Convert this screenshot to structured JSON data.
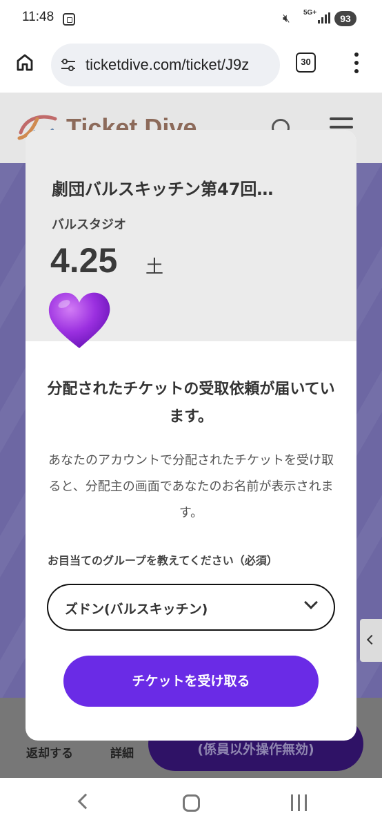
{
  "status_bar": {
    "time": "11:48",
    "network": "5G+",
    "battery": "93"
  },
  "browser": {
    "url": "ticketdive.com/ticket/J9z",
    "tab_count": "30"
  },
  "page": {
    "logo_text": "Ticket Dive",
    "footer": {
      "return_label": "返却する",
      "detail_label": "詳細",
      "operate_label": "(係員以外操作無効)"
    }
  },
  "modal": {
    "title": "劇団バルスキッチン第47回…",
    "venue": "バルスタジオ",
    "date": "4.25",
    "day": "土",
    "heart_icon": "purple-heart",
    "notice_heading": "分配されたチケットの受取依頼が届いています。",
    "notice_body": "あなたのアカウントで分配されたチケットを受け取ると、分配主の画面であなたのお名前が表示されます。",
    "group_label": "お目当てのグループを教えてください（必須）",
    "group_selected": "ズドン(バルスキッチン)",
    "receive_button": "チケットを受け取る"
  },
  "colors": {
    "accent": "#6a2be6",
    "overlay_purple": "#6d67a3",
    "heart": "#9b30e0"
  }
}
